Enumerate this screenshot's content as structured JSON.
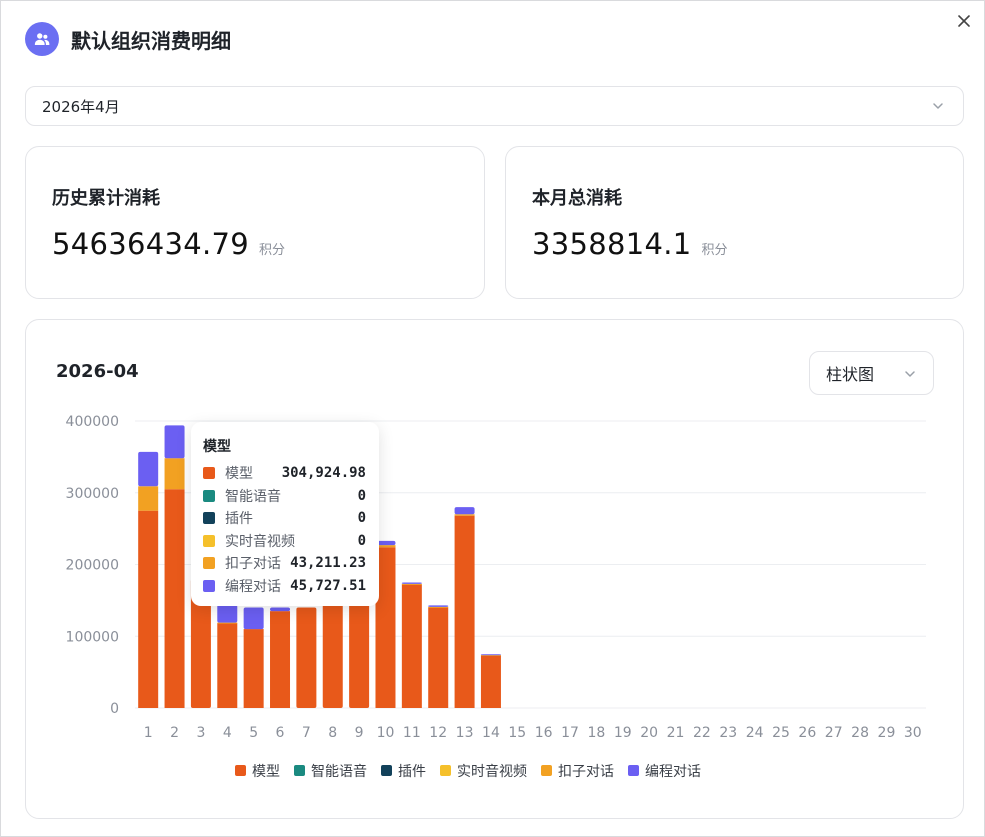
{
  "header": {
    "title": "默认组织消费明细",
    "avatar_icon": "users-icon"
  },
  "month_select": {
    "value": "2026年4月"
  },
  "stats": [
    {
      "label": "历史累计消耗",
      "value": "54636434.79",
      "unit": "积分"
    },
    {
      "label": "本月总消耗",
      "value": "3358814.1",
      "unit": "积分"
    }
  ],
  "chart_card": {
    "title": "2026-04",
    "type_select": "柱状图"
  },
  "colors": {
    "模型": "#e8591a",
    "智能语音": "#1a8a80",
    "插件": "#12415a",
    "实时音视频": "#f5c02b",
    "扣子对话": "#f2a122",
    "编程对话": "#6b5ff2"
  },
  "tooltip": {
    "title": "模型",
    "rows": [
      {
        "name": "模型",
        "value": "304,924.98",
        "color": "#e8591a"
      },
      {
        "name": "智能语音",
        "value": "0",
        "color": "#1a8a80"
      },
      {
        "name": "插件",
        "value": "0",
        "color": "#12415a"
      },
      {
        "name": "实时音视频",
        "value": "0",
        "color": "#f5c02b"
      },
      {
        "name": "扣子对话",
        "value": "43,211.23",
        "color": "#f2a122"
      },
      {
        "name": "编程对话",
        "value": "45,727.51",
        "color": "#6b5ff2"
      }
    ]
  },
  "chart_data": {
    "type": "bar",
    "stacked": true,
    "categories": [
      "1",
      "2",
      "3",
      "4",
      "5",
      "6",
      "7",
      "8",
      "9",
      "10",
      "11",
      "12",
      "13",
      "14",
      "15",
      "16",
      "17",
      "18",
      "19",
      "20",
      "21",
      "22",
      "23",
      "24",
      "25",
      "26",
      "27",
      "28",
      "29",
      "30"
    ],
    "ylim": [
      0,
      400000
    ],
    "yticks": [
      0,
      100000,
      200000,
      300000,
      400000
    ],
    "ytick_labels": [
      "0",
      "100000",
      "200000",
      "300000",
      "400000"
    ],
    "grid": true,
    "legend_position": "bottom",
    "series": [
      {
        "name": "模型",
        "color": "#e8591a",
        "values": [
          275000,
          304924.98,
          180000,
          118000,
          110000,
          135000,
          140000,
          145000,
          150000,
          224000,
          172000,
          140000,
          268000,
          73000,
          0,
          0,
          0,
          0,
          0,
          0,
          0,
          0,
          0,
          0,
          0,
          0,
          0,
          0,
          0,
          0
        ]
      },
      {
        "name": "智能语音",
        "color": "#1a8a80",
        "values": [
          0,
          0,
          0,
          0,
          0,
          0,
          0,
          0,
          0,
          0,
          0,
          0,
          0,
          0,
          0,
          0,
          0,
          0,
          0,
          0,
          0,
          0,
          0,
          0,
          0,
          0,
          0,
          0,
          0,
          0
        ]
      },
      {
        "name": "插件",
        "color": "#12415a",
        "values": [
          0,
          0,
          0,
          0,
          0,
          0,
          0,
          0,
          0,
          0,
          0,
          0,
          0,
          0,
          0,
          0,
          0,
          0,
          0,
          0,
          0,
          0,
          0,
          0,
          0,
          0,
          0,
          0,
          0,
          0
        ]
      },
      {
        "name": "实时音视频",
        "color": "#f5c02b",
        "values": [
          0,
          0,
          0,
          0,
          0,
          0,
          0,
          0,
          0,
          0,
          0,
          0,
          0,
          0,
          0,
          0,
          0,
          0,
          0,
          0,
          0,
          0,
          0,
          0,
          0,
          0,
          0,
          0,
          0,
          0
        ]
      },
      {
        "name": "扣子对话",
        "color": "#f2a122",
        "values": [
          34000,
          43211.23,
          0,
          1000,
          0,
          0,
          0,
          0,
          0,
          3000,
          1000,
          1000,
          2000,
          1000,
          0,
          0,
          0,
          0,
          0,
          0,
          0,
          0,
          0,
          0,
          0,
          0,
          0,
          0,
          0,
          0
        ]
      },
      {
        "name": "编程对话",
        "color": "#6b5ff2",
        "values": [
          48000,
          45727.51,
          0,
          25000,
          30000,
          5000,
          0,
          0,
          0,
          6000,
          2000,
          2000,
          10000,
          1000,
          0,
          0,
          0,
          0,
          0,
          0,
          0,
          0,
          0,
          0,
          0,
          0,
          0,
          0,
          0,
          0
        ]
      }
    ]
  }
}
